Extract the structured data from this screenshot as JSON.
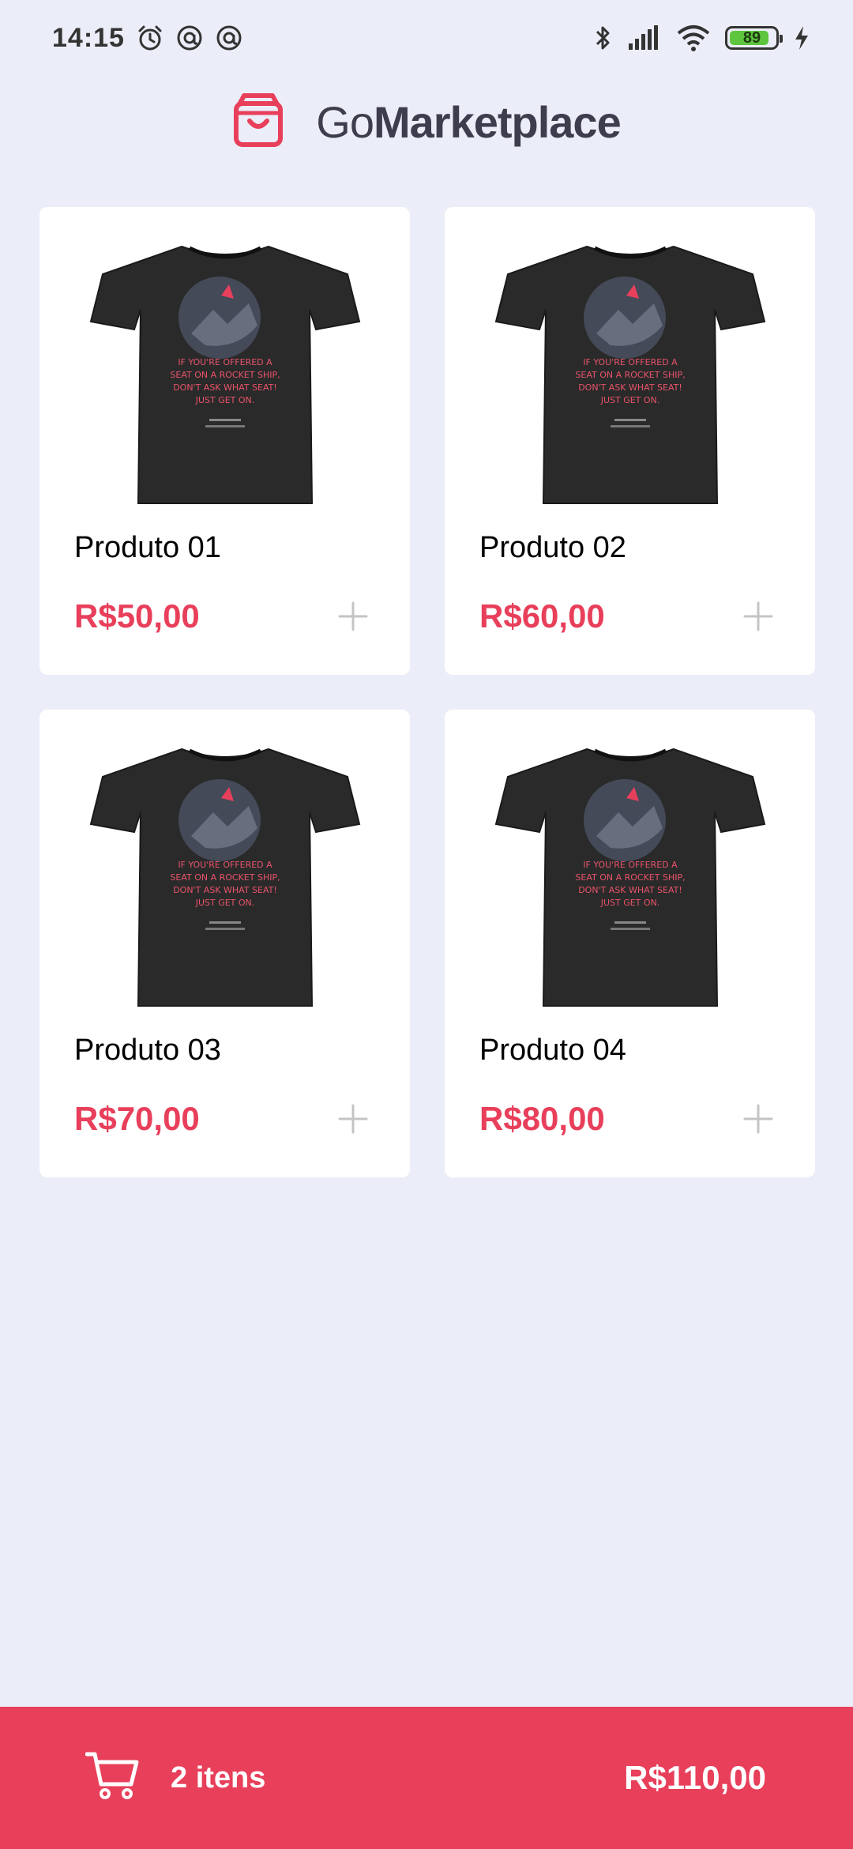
{
  "status_bar": {
    "time": "14:15",
    "battery_level": "89",
    "battery_fraction": 0.89,
    "icons": [
      "alarm-icon",
      "at-sign-icon",
      "at-sign-icon",
      "bluetooth-icon",
      "signal-icon",
      "wifi-icon",
      "battery-icon",
      "charging-icon"
    ]
  },
  "header": {
    "brand_prefix": "Go",
    "brand_suffix": "Marketplace",
    "logo_icon": "shopping-bag-icon"
  },
  "products": [
    {
      "title": "Produto 01",
      "price": "R$50,00",
      "shirt_text": [
        "IF YOU'RE OFFERED A",
        "SEAT ON A ROCKET SHIP,",
        "DON'T ASK WHAT SEAT!",
        "JUST GET ON."
      ]
    },
    {
      "title": "Produto 02",
      "price": "R$60,00",
      "shirt_text": [
        "IF YOU'RE OFFERED A",
        "SEAT ON A ROCKET SHIP,",
        "DON'T ASK WHAT SEAT!",
        "JUST GET ON."
      ]
    },
    {
      "title": "Produto 03",
      "price": "R$70,00",
      "shirt_text": [
        "IF YOU'RE OFFERED A",
        "SEAT ON A ROCKET SHIP,",
        "DON'T ASK WHAT SEAT!",
        "JUST GET ON."
      ]
    },
    {
      "title": "Produto 04",
      "price": "R$80,00",
      "shirt_text": [
        "IF YOU'RE OFFERED A",
        "SEAT ON A ROCKET SHIP,",
        "DON'T ASK WHAT SEAT!",
        "JUST GET ON."
      ]
    }
  ],
  "cart": {
    "count_label": "2 itens",
    "total": "R$110,00",
    "icon": "cart-icon"
  },
  "colors": {
    "background": "#EBEEF8",
    "accent": "#E83F5B",
    "card": "#FFFFFF",
    "title_text": "#3D3D4D",
    "add_icon": "#C4C4C4",
    "shirt": "#2A2A2A"
  }
}
